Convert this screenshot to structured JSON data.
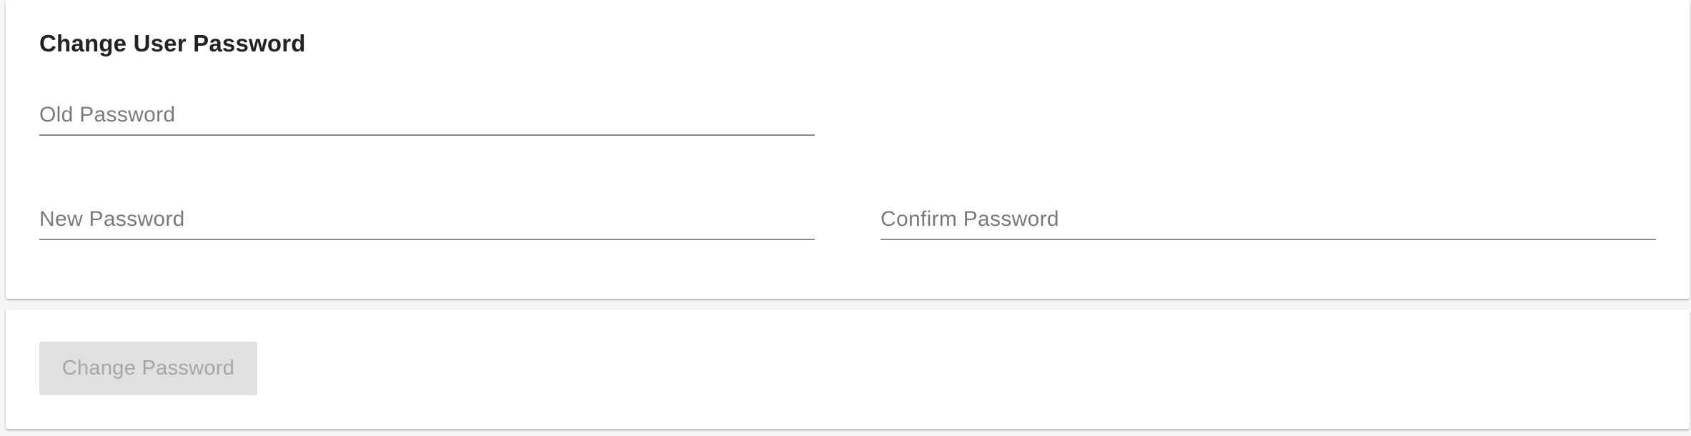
{
  "form": {
    "title": "Change User Password",
    "fields": {
      "old_password": {
        "label": "Old Password",
        "value": ""
      },
      "new_password": {
        "label": "New Password",
        "value": ""
      },
      "confirm_password": {
        "label": "Confirm Password",
        "value": ""
      }
    }
  },
  "actions": {
    "change_password_label": "Change Password",
    "change_password_disabled": true
  },
  "colors": {
    "background": "#f5f5f5",
    "card": "#ffffff",
    "title_text": "#222222",
    "label_text": "#7a7a7a",
    "underline": "#8c8c8c",
    "button_disabled_bg": "#e0e0e0",
    "button_disabled_text": "#a6a6a6"
  }
}
